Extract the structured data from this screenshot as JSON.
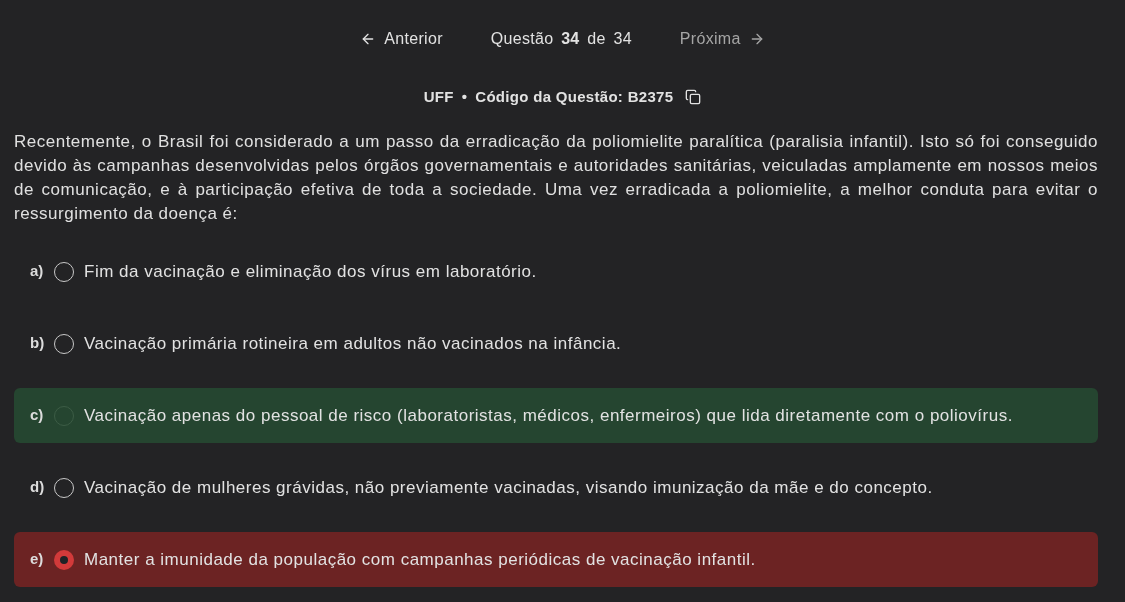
{
  "nav": {
    "previous": {
      "label": "Anterior",
      "disabled": false
    },
    "counter": "Questão **34** de 34",
    "next": {
      "label": "Próxima",
      "disabled": true
    }
  },
  "header": {
    "source": "UFF",
    "separator": "•",
    "code": "Código da Questão: B2375"
  },
  "statement": "Recentemente, o Brasil foi considerado a um passo da erradicação da poliomielite paralítica (paralisia infantil). Isto só foi conseguido devido às campanhas desenvolvidas pelos órgãos governamentais e autoridades sanitárias, veiculadas amplamente em nossos meios de comunicação, e à participação efetiva de toda a sociedade. Uma vez erradicada a poliomielite, a melhor conduta para evitar o ressurgimento da doença é:",
  "options": [
    {
      "letter": "a)",
      "text": "Fim da vacinação e eliminação dos vírus em laboratório.",
      "selected": false,
      "correct": false
    },
    {
      "letter": "b)",
      "text": "Vacinação primária rotineira em adultos não vacinados na infância.",
      "selected": false,
      "correct": false
    },
    {
      "letter": "c)",
      "text": "Vacinação apenas do pessoal de risco (laboratoristas, médicos, enfermeiros) que lida diretamente com o poliovírus.",
      "selected": false,
      "correct": true
    },
    {
      "letter": "d)",
      "text": "Vacinação de mulheres grávidas, não previamente vacinadas, visando imunização da mãe e do concepto.",
      "selected": false,
      "correct": false
    },
    {
      "letter": "e)",
      "text": "Manter a imunidade da população com campanhas periódicas de vacinação infantil.",
      "selected": true,
      "correct": false
    }
  ]
}
